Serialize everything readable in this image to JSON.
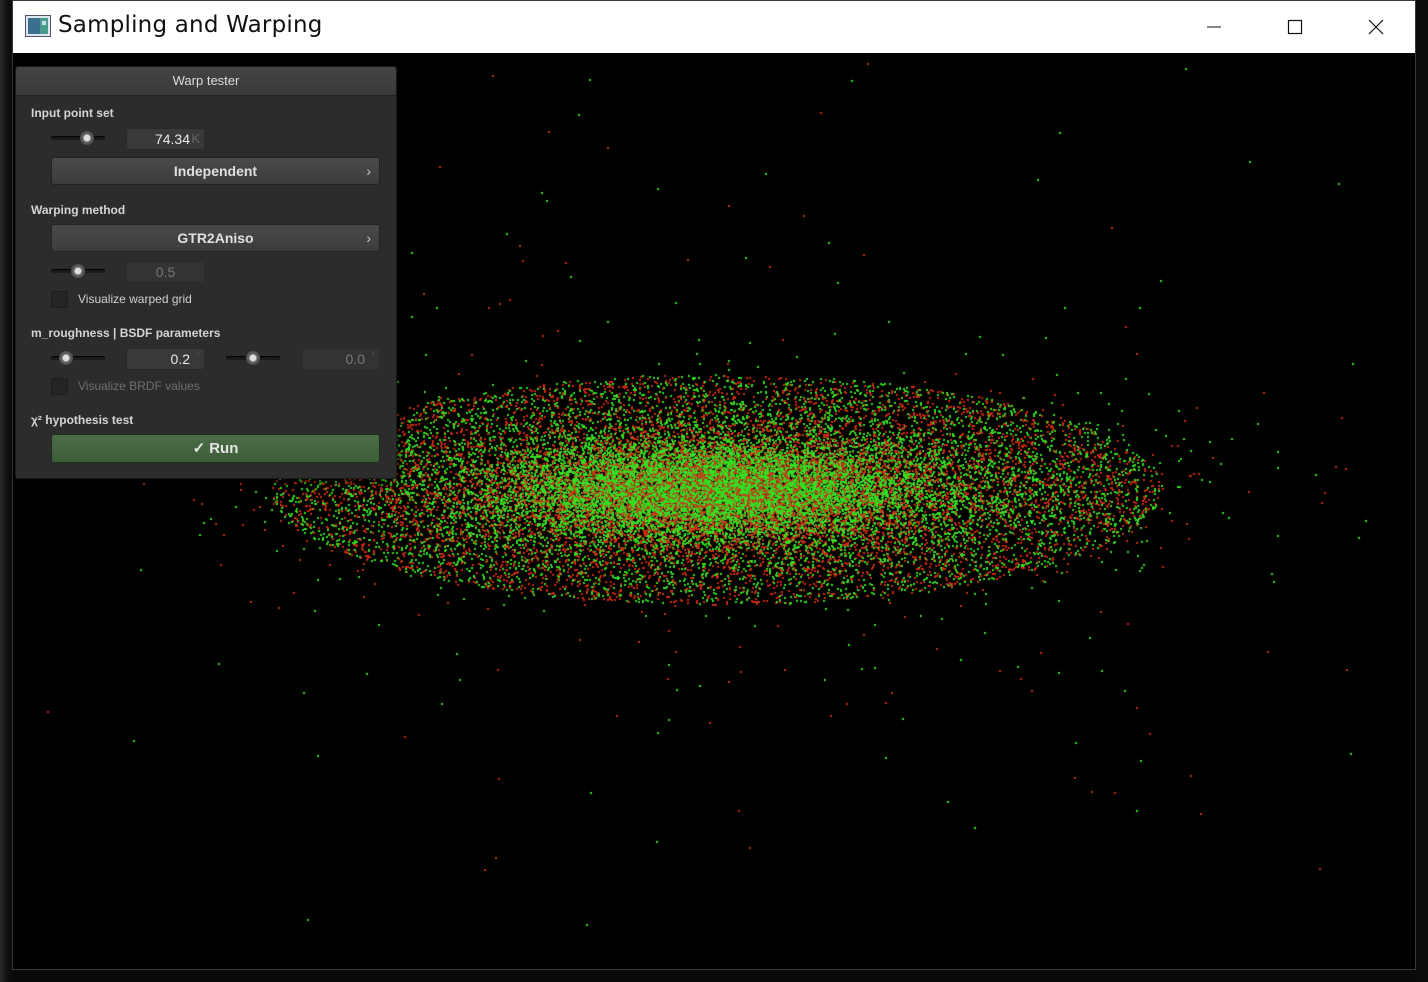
{
  "window": {
    "title": "Sampling and Warping",
    "controls": {
      "minimize": "—",
      "maximize": "☐",
      "close": "✕"
    }
  },
  "panel": {
    "title": "Warp tester",
    "input_point_set": {
      "label": "Input point set",
      "count_slider_level": 0.72,
      "count_value": "74.34",
      "count_unit": "K",
      "sampler": "Independent"
    },
    "warping_method": {
      "label": "Warping method",
      "method": "GTR2Aniso",
      "param_slider_level": 0.5,
      "param_value": "0.5",
      "visualize_grid_label": "Visualize warped grid",
      "visualize_grid_checked": false
    },
    "bsdf": {
      "label": "m_roughness | BSDF parameters",
      "roughness_slider_level": 0.2,
      "roughness_value": "0.2",
      "second_slider_level": 0.5,
      "second_value": "0.0",
      "visualize_brdf_label": "Visualize BRDF values",
      "visualize_brdf_checked": false
    },
    "test": {
      "label": "χ² hypothesis test",
      "run_label": "Run",
      "run_icon": "checkmark-icon"
    }
  },
  "colors": {
    "point_green": "#33dd22",
    "point_red": "#cc2a10",
    "panel_bg": "#2c2c2c",
    "run_button": "#456640"
  }
}
